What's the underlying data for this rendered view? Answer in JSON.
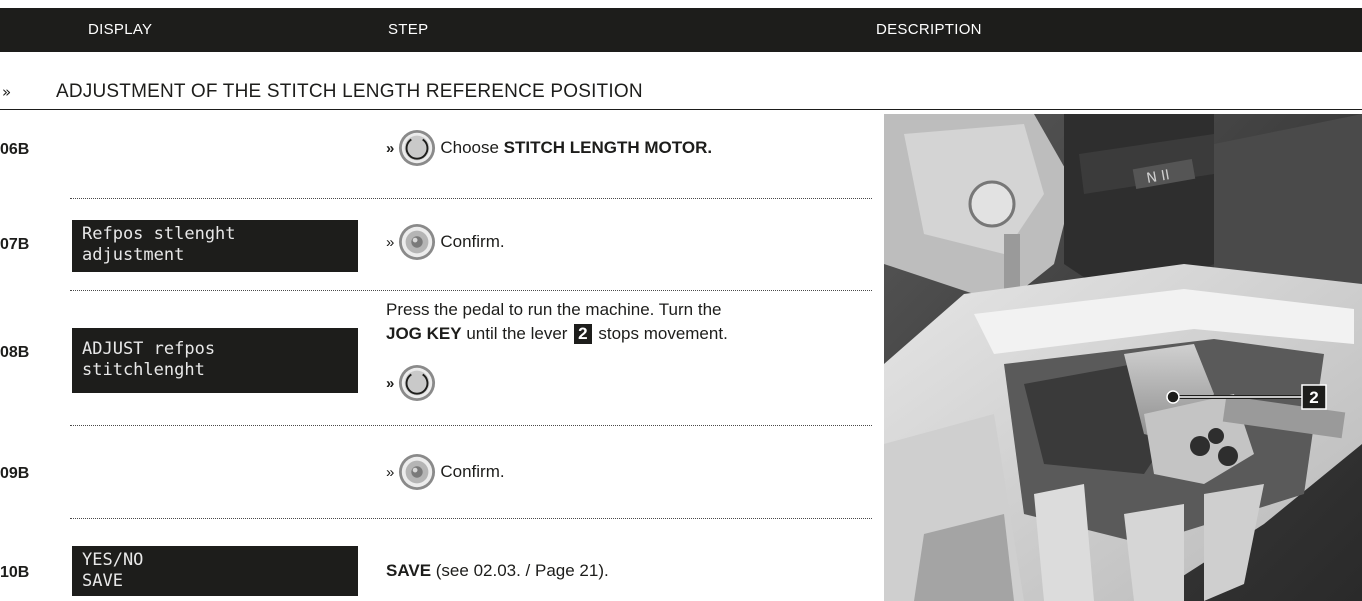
{
  "header": {
    "col_display": "DISPLAY",
    "col_step": "STEP",
    "col_description": "DESCRIPTION"
  },
  "section": {
    "chevron": "»",
    "title": "ADJUSTMENT OF THE STITCH LENGTH REFERENCE POSITION"
  },
  "rows": [
    {
      "id": "06B",
      "step_prefix": "»",
      "step_text_pre": "Choose ",
      "step_text_bold": "STITCH LENGTH MOTOR."
    },
    {
      "id": "07B",
      "display_line1": "Refpos stlenght",
      "display_line2": "adjustment",
      "step_prefix": "»",
      "step_text": "Confirm."
    },
    {
      "id": "08B",
      "display_line1": "ADJUST refpos",
      "display_line2": "stitchlenght",
      "desc_1": "Press the pedal to run the machine. Turn the",
      "desc_bold": "JOG KEY",
      "desc_2": " until the lever ",
      "desc_badge": "2",
      "desc_3": " stops movement.",
      "step_prefix": "»"
    },
    {
      "id": "09B",
      "step_prefix": "»",
      "step_text": "Confirm."
    },
    {
      "id": "10B",
      "display_line1": "YES/NO",
      "display_line2": "SAVE",
      "step_text_bold": "SAVE",
      "step_text_post": " (see 02.03. / Page 21)."
    }
  ],
  "photo": {
    "callout_label": "2"
  },
  "colors": {
    "dark": "#1d1d1b",
    "lcd_text": "#e8e8e8"
  }
}
